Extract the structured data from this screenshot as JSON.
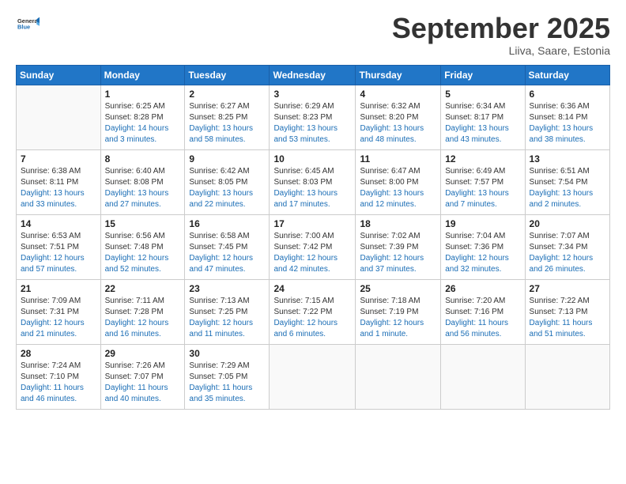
{
  "logo": {
    "line1": "General",
    "line2": "Blue"
  },
  "title": "September 2025",
  "location": "Liiva, Saare, Estonia",
  "days_of_week": [
    "Sunday",
    "Monday",
    "Tuesday",
    "Wednesday",
    "Thursday",
    "Friday",
    "Saturday"
  ],
  "weeks": [
    [
      {
        "day": "",
        "sunrise": "",
        "sunset": "",
        "daylight": ""
      },
      {
        "day": "1",
        "sunrise": "Sunrise: 6:25 AM",
        "sunset": "Sunset: 8:28 PM",
        "daylight": "Daylight: 14 hours and 3 minutes."
      },
      {
        "day": "2",
        "sunrise": "Sunrise: 6:27 AM",
        "sunset": "Sunset: 8:25 PM",
        "daylight": "Daylight: 13 hours and 58 minutes."
      },
      {
        "day": "3",
        "sunrise": "Sunrise: 6:29 AM",
        "sunset": "Sunset: 8:23 PM",
        "daylight": "Daylight: 13 hours and 53 minutes."
      },
      {
        "day": "4",
        "sunrise": "Sunrise: 6:32 AM",
        "sunset": "Sunset: 8:20 PM",
        "daylight": "Daylight: 13 hours and 48 minutes."
      },
      {
        "day": "5",
        "sunrise": "Sunrise: 6:34 AM",
        "sunset": "Sunset: 8:17 PM",
        "daylight": "Daylight: 13 hours and 43 minutes."
      },
      {
        "day": "6",
        "sunrise": "Sunrise: 6:36 AM",
        "sunset": "Sunset: 8:14 PM",
        "daylight": "Daylight: 13 hours and 38 minutes."
      }
    ],
    [
      {
        "day": "7",
        "sunrise": "Sunrise: 6:38 AM",
        "sunset": "Sunset: 8:11 PM",
        "daylight": "Daylight: 13 hours and 33 minutes."
      },
      {
        "day": "8",
        "sunrise": "Sunrise: 6:40 AM",
        "sunset": "Sunset: 8:08 PM",
        "daylight": "Daylight: 13 hours and 27 minutes."
      },
      {
        "day": "9",
        "sunrise": "Sunrise: 6:42 AM",
        "sunset": "Sunset: 8:05 PM",
        "daylight": "Daylight: 13 hours and 22 minutes."
      },
      {
        "day": "10",
        "sunrise": "Sunrise: 6:45 AM",
        "sunset": "Sunset: 8:03 PM",
        "daylight": "Daylight: 13 hours and 17 minutes."
      },
      {
        "day": "11",
        "sunrise": "Sunrise: 6:47 AM",
        "sunset": "Sunset: 8:00 PM",
        "daylight": "Daylight: 13 hours and 12 minutes."
      },
      {
        "day": "12",
        "sunrise": "Sunrise: 6:49 AM",
        "sunset": "Sunset: 7:57 PM",
        "daylight": "Daylight: 13 hours and 7 minutes."
      },
      {
        "day": "13",
        "sunrise": "Sunrise: 6:51 AM",
        "sunset": "Sunset: 7:54 PM",
        "daylight": "Daylight: 13 hours and 2 minutes."
      }
    ],
    [
      {
        "day": "14",
        "sunrise": "Sunrise: 6:53 AM",
        "sunset": "Sunset: 7:51 PM",
        "daylight": "Daylight: 12 hours and 57 minutes."
      },
      {
        "day": "15",
        "sunrise": "Sunrise: 6:56 AM",
        "sunset": "Sunset: 7:48 PM",
        "daylight": "Daylight: 12 hours and 52 minutes."
      },
      {
        "day": "16",
        "sunrise": "Sunrise: 6:58 AM",
        "sunset": "Sunset: 7:45 PM",
        "daylight": "Daylight: 12 hours and 47 minutes."
      },
      {
        "day": "17",
        "sunrise": "Sunrise: 7:00 AM",
        "sunset": "Sunset: 7:42 PM",
        "daylight": "Daylight: 12 hours and 42 minutes."
      },
      {
        "day": "18",
        "sunrise": "Sunrise: 7:02 AM",
        "sunset": "Sunset: 7:39 PM",
        "daylight": "Daylight: 12 hours and 37 minutes."
      },
      {
        "day": "19",
        "sunrise": "Sunrise: 7:04 AM",
        "sunset": "Sunset: 7:36 PM",
        "daylight": "Daylight: 12 hours and 32 minutes."
      },
      {
        "day": "20",
        "sunrise": "Sunrise: 7:07 AM",
        "sunset": "Sunset: 7:34 PM",
        "daylight": "Daylight: 12 hours and 26 minutes."
      }
    ],
    [
      {
        "day": "21",
        "sunrise": "Sunrise: 7:09 AM",
        "sunset": "Sunset: 7:31 PM",
        "daylight": "Daylight: 12 hours and 21 minutes."
      },
      {
        "day": "22",
        "sunrise": "Sunrise: 7:11 AM",
        "sunset": "Sunset: 7:28 PM",
        "daylight": "Daylight: 12 hours and 16 minutes."
      },
      {
        "day": "23",
        "sunrise": "Sunrise: 7:13 AM",
        "sunset": "Sunset: 7:25 PM",
        "daylight": "Daylight: 12 hours and 11 minutes."
      },
      {
        "day": "24",
        "sunrise": "Sunrise: 7:15 AM",
        "sunset": "Sunset: 7:22 PM",
        "daylight": "Daylight: 12 hours and 6 minutes."
      },
      {
        "day": "25",
        "sunrise": "Sunrise: 7:18 AM",
        "sunset": "Sunset: 7:19 PM",
        "daylight": "Daylight: 12 hours and 1 minute."
      },
      {
        "day": "26",
        "sunrise": "Sunrise: 7:20 AM",
        "sunset": "Sunset: 7:16 PM",
        "daylight": "Daylight: 11 hours and 56 minutes."
      },
      {
        "day": "27",
        "sunrise": "Sunrise: 7:22 AM",
        "sunset": "Sunset: 7:13 PM",
        "daylight": "Daylight: 11 hours and 51 minutes."
      }
    ],
    [
      {
        "day": "28",
        "sunrise": "Sunrise: 7:24 AM",
        "sunset": "Sunset: 7:10 PM",
        "daylight": "Daylight: 11 hours and 46 minutes."
      },
      {
        "day": "29",
        "sunrise": "Sunrise: 7:26 AM",
        "sunset": "Sunset: 7:07 PM",
        "daylight": "Daylight: 11 hours and 40 minutes."
      },
      {
        "day": "30",
        "sunrise": "Sunrise: 7:29 AM",
        "sunset": "Sunset: 7:05 PM",
        "daylight": "Daylight: 11 hours and 35 minutes."
      },
      {
        "day": "",
        "sunrise": "",
        "sunset": "",
        "daylight": ""
      },
      {
        "day": "",
        "sunrise": "",
        "sunset": "",
        "daylight": ""
      },
      {
        "day": "",
        "sunrise": "",
        "sunset": "",
        "daylight": ""
      },
      {
        "day": "",
        "sunrise": "",
        "sunset": "",
        "daylight": ""
      }
    ]
  ]
}
